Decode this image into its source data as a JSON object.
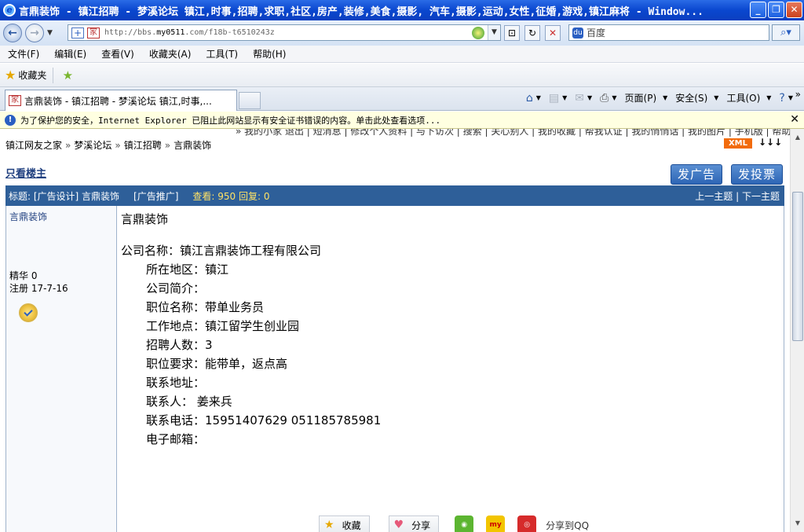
{
  "window": {
    "title": "言鼎装饰 - 镇江招聘 - 梦溪论坛 镇江,时事,招聘,求职,社区,房产,装修,美食,摄影, 汽车,摄影,运动,女性,征婚,游戏,镇江麻将 - Window...",
    "min": "_",
    "restore": "❐",
    "close": "✕"
  },
  "address": {
    "url_prefix": "http://bbs.",
    "url_domain": "my0511",
    "url_rest": ".com/f18b-t6510243z",
    "search_placeholder": "百度",
    "fav_glyph": "家"
  },
  "menu": [
    "文件(F)",
    "编辑(E)",
    "查看(V)",
    "收藏夹(A)",
    "工具(T)",
    "帮助(H)"
  ],
  "favorites": {
    "label": "收藏夹"
  },
  "tab": {
    "title": "言鼎装饰 - 镇江招聘 - 梦溪论坛 镇江,时事,..."
  },
  "commandbar": {
    "page": "页面(P)",
    "safety": "安全(S)",
    "tools": "工具(O)"
  },
  "infobar": {
    "text": "为了保护您的安全，Internet Explorer 已阻止此网站显示有安全证书错误的内容。单击此处查看选项..."
  },
  "topnav_cut": "» 我的小家 退出 | 短消息 | 修改个人资料 | 与下访次 | 搜索 | 关心别人 | 我的收藏 | 帮我认证 | 我的悄悄话 | 我的图片 | 手机版 | 帮助",
  "breadcrumb": [
    "镇江网友之家",
    "梦溪论坛",
    "镇江招聘",
    "言鼎装饰"
  ],
  "breadcrumb_sep": "»",
  "xml_badge": "XML",
  "arrows": "↓↓↓",
  "only_owner": "只看楼主",
  "buttons": {
    "ad": "发广告",
    "poll": "发投票"
  },
  "thread": {
    "subject": "标题: [广告设计] 言鼎装饰",
    "category": "[广告推广]",
    "stats": "查看: 950  回复: 0",
    "prev": "上一主题",
    "next": "下一主题",
    "sep": " | "
  },
  "author": {
    "name": "言鼎装饰",
    "essence": "精华  0",
    "registered": "注册  17-7-16"
  },
  "post": {
    "title": "言鼎装饰",
    "company": "公司名称：镇江言鼎装饰工程有限公司",
    "lines": [
      "所在地区：镇江",
      "公司简介：",
      "职位名称：带单业务员",
      "工作地点：镇江留学生创业园",
      "招聘人数：3",
      "职位要求：能带单，返点高",
      "联系地址：",
      "联系人：   姜来兵",
      "联系电话：15951407629  051185785981",
      "电子邮箱："
    ]
  },
  "bottom": {
    "collect": "收藏",
    "share": "分享",
    "share_qq": "分享到QQ"
  }
}
